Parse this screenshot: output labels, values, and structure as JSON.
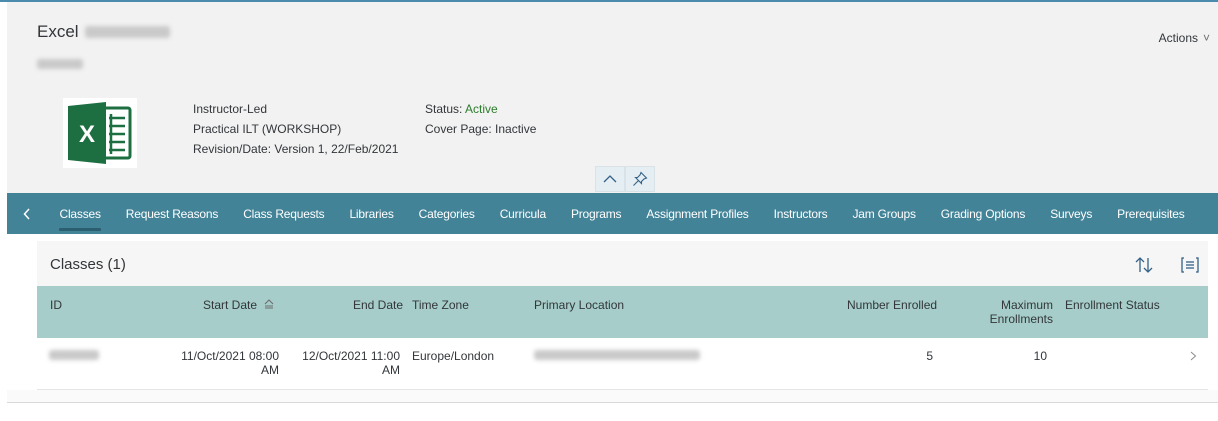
{
  "header": {
    "title": "Excel",
    "actions_label": "Actions",
    "details": {
      "delivery_method": "Instructor-Led",
      "type": "Practical ILT (WORKSHOP)",
      "revision": "Revision/Date: Version 1, 22/Feb/2021"
    },
    "status": {
      "status_label": "Status: ",
      "status_value": "Active",
      "cover_page": "Cover Page: Inactive"
    }
  },
  "tabs": [
    {
      "label": "Classes",
      "selected": true
    },
    {
      "label": "Request Reasons"
    },
    {
      "label": "Class Requests"
    },
    {
      "label": "Libraries"
    },
    {
      "label": "Categories"
    },
    {
      "label": "Curricula"
    },
    {
      "label": "Programs"
    },
    {
      "label": "Assignment Profiles"
    },
    {
      "label": "Instructors"
    },
    {
      "label": "Jam Groups"
    },
    {
      "label": "Grading Options"
    },
    {
      "label": "Surveys"
    },
    {
      "label": "Prerequisites"
    }
  ],
  "classes": {
    "title": "Classes (1)",
    "columns": {
      "id": "ID",
      "start_date": "Start Date",
      "end_date": "End Date",
      "time_zone": "Time Zone",
      "primary_location": "Primary Location",
      "number_enrolled": "Number Enrolled",
      "max_enrollments_line1": "Maximum",
      "max_enrollments_line2": "Enrollments",
      "enrollment_status": "Enrollment Status"
    },
    "rows": [
      {
        "start_line1": "11/Oct/2021 08:00",
        "start_line2": "AM",
        "end_line1": "12/Oct/2021 11:00",
        "end_line2": "AM",
        "time_zone": "Europe/London",
        "number_enrolled": "5",
        "max_enrollments": "10",
        "enrollment_status": ""
      }
    ]
  },
  "colors": {
    "tabbar": "#438398",
    "table_header": "#a6cdc9",
    "status_active": "#2b7d2b",
    "excel_green": "#1d6f42"
  }
}
